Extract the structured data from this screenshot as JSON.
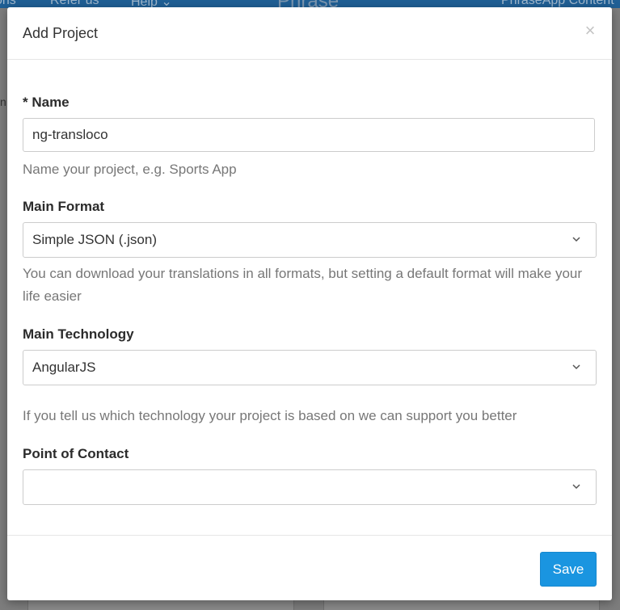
{
  "background": {
    "nav_items": [
      "ons",
      "Refer us",
      "Help ⌄"
    ],
    "brand": "Phrase",
    "right_nav": "PhraseApp Content",
    "side_text": "n"
  },
  "modal": {
    "title": "Add Project",
    "close_glyph": "×",
    "fields": {
      "name": {
        "label": "* Name",
        "value": "ng-transloco",
        "help": "Name your project, e.g. Sports App"
      },
      "main_format": {
        "label": "Main Format",
        "selected": "Simple JSON (.json)",
        "help": "You can download your translations in all formats, but setting a default format will make your life easier"
      },
      "main_technology": {
        "label": "Main Technology",
        "selected": "AngularJS",
        "help": "If you tell us which technology your project is based on we can support you better"
      },
      "point_of_contact": {
        "label": "Point of Contact",
        "selected": ""
      }
    },
    "save_label": "Save"
  },
  "colors": {
    "primary_button": "#1a95e0",
    "help_text": "#777777",
    "border": "#cccccc",
    "overlay": "#7d7d7d"
  },
  "icons": {
    "close": "close-icon",
    "dropdown": "chevron-down-icon"
  }
}
